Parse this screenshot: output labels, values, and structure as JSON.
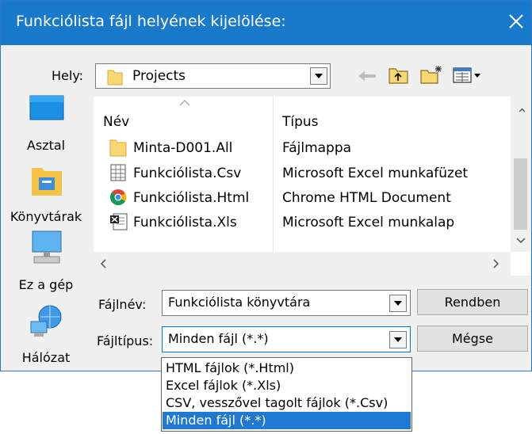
{
  "dialog": {
    "title": "Funkciólista fájl helyének kijelölése:",
    "look_in_label": "Hely:",
    "look_in_value": "Projects"
  },
  "places": [
    {
      "label": "Asztal",
      "icon": "desktop-icon"
    },
    {
      "label": "Könyvtárak",
      "icon": "libraries-icon"
    },
    {
      "label": "Ez a gép",
      "icon": "computer-icon"
    },
    {
      "label": "Hálózat",
      "icon": "network-icon"
    }
  ],
  "file_list": {
    "columns": [
      "Név",
      "Típus"
    ],
    "rows": [
      {
        "name": "Minta-D001.All",
        "type": "Fájlmappa",
        "icon": "folder-icon"
      },
      {
        "name": "Funkciólista.Csv",
        "type": "Microsoft Excel munkafüzet",
        "icon": "csv-file-icon"
      },
      {
        "name": "Funkciólista.Html",
        "type": "Chrome HTML Document",
        "icon": "chrome-icon"
      },
      {
        "name": "Funkciólista.Xls",
        "type": "Microsoft Excel munkalap",
        "icon": "xls-file-icon"
      }
    ]
  },
  "filename": {
    "label": "Fájlnév:",
    "value": "Funkciólista könyvtára"
  },
  "filetype": {
    "label": "Fájltípus:",
    "value": "Minden fájl (*.*)",
    "options": [
      "HTML fájlok (*.Html)",
      "Excel fájlok (*.Xls)",
      "CSV, vesszővel tagolt fájlok (*.Csv)",
      "Minden fájl (*.*)"
    ],
    "selected_index": 3
  },
  "buttons": {
    "ok": "Rendben",
    "cancel": "Mégse"
  },
  "colors": {
    "titlebar": "#1979ca",
    "selection": "#1f78d1",
    "dialog_bg": "#f0f0f0"
  }
}
